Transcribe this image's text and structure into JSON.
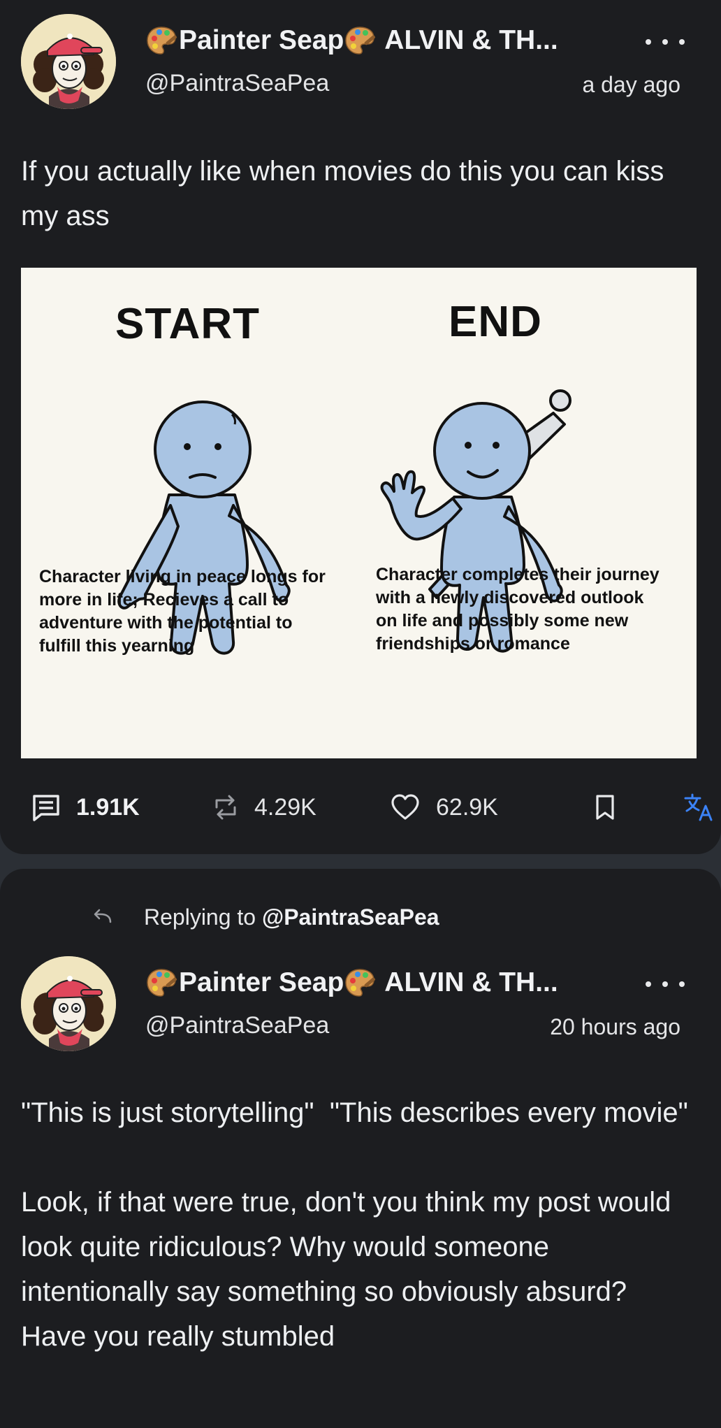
{
  "posts": [
    {
      "author_name": "Painter Seap",
      "group_name": "ALVIN & TH...",
      "handle": "@PaintraSeaPea",
      "time": "a day ago",
      "body": "If you actually like when movies do this you can kiss my ass",
      "image": {
        "left_heading": "START",
        "right_heading": "END",
        "left_caption": "Character living in peace longs for\nmore in life; Recieves a call to\nadventure with the potential to\nfulfill this yearning",
        "right_caption": "Character completes their journey\nwith a newly discovered outlook\non life and possibly some new\nfriendships or romance"
      },
      "stats": {
        "comments": "1.91K",
        "reposts": "4.29K",
        "likes": "62.9K"
      },
      "icons": [
        "comment-icon",
        "repost-icon",
        "heart-icon",
        "bookmark-icon",
        "translate-icon"
      ]
    },
    {
      "replying_prefix": "Replying to",
      "replying_to": "@PaintraSeaPea",
      "author_name": "Painter Seap",
      "group_name": "ALVIN & TH...",
      "handle": "@PaintraSeaPea",
      "time": "20 hours ago",
      "body": "\"This is just storytelling\"  \"This describes every movie\"\n\nLook, if that were true, don't you think my post would look quite ridiculous? Why would someone intentionally say something so obviously absurd? Have you really stumbled"
    }
  ],
  "colors": {
    "background": "#2b2f35",
    "card": "#1c1d20",
    "text": "#eef0f2",
    "accent_translate": "#3b82f6",
    "figure_blue": "#a9c4e3"
  }
}
